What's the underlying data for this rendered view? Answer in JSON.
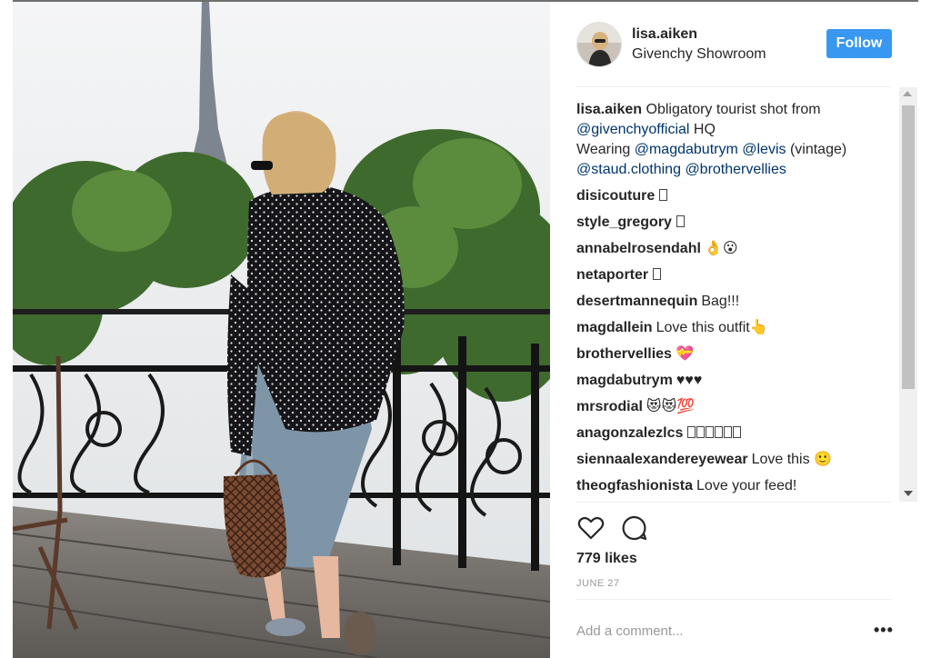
{
  "post": {
    "username": "lisa.aiken",
    "location": "Givenchy Showroom",
    "follow_label": "Follow"
  },
  "caption": {
    "user": "lisa.aiken",
    "lines": [
      [
        {
          "t": "Obligatory tourist shot from",
          "k": "text"
        }
      ],
      [
        {
          "t": "@givenchyofficial",
          "k": "mention"
        },
        {
          "t": " HQ",
          "k": "text"
        }
      ],
      [
        {
          "t": "Wearing ",
          "k": "text"
        },
        {
          "t": "@magdabutrym",
          "k": "mention"
        },
        {
          "t": " ",
          "k": "text"
        },
        {
          "t": "@levis",
          "k": "mention"
        },
        {
          "t": " (vintage)",
          "k": "text"
        }
      ],
      [
        {
          "t": "@staud.clothing",
          "k": "mention"
        },
        {
          "t": " ",
          "k": "text"
        },
        {
          "t": "@brothervellies",
          "k": "mention"
        }
      ]
    ]
  },
  "comments": [
    {
      "user": "disicouture",
      "text": "",
      "boxes": 1
    },
    {
      "user": "style_gregory",
      "text": "",
      "boxes": 1
    },
    {
      "user": "annabelrosendahl",
      "text": "👌😮",
      "boxes": 0
    },
    {
      "user": "netaporter",
      "text": "",
      "boxes": 1
    },
    {
      "user": "desertmannequin",
      "text": "Bag!!!",
      "boxes": 0
    },
    {
      "user": "magdallein",
      "text": "Love this outfit👆",
      "boxes": 0
    },
    {
      "user": "brothervellies",
      "text": "💝",
      "boxes": 0
    },
    {
      "user": "magdabutrym",
      "text": "♥♥♥",
      "boxes": 0
    },
    {
      "user": "mrsrodial",
      "text": "😻😻💯",
      "boxes": 0
    },
    {
      "user": "anagonzalezlcs",
      "text": "",
      "boxes": 6
    },
    {
      "user": "siennaalexandereyewear",
      "text": "Love this 🙂",
      "boxes": 0
    },
    {
      "user": "theogfashionista",
      "text": "Love your feed!",
      "boxes": 0
    }
  ],
  "icons": {
    "like": "heart-icon",
    "comment": "comment-bubble-icon",
    "more": "more-options-icon"
  },
  "likes": "779 likes",
  "date": "JUNE 27",
  "add_comment_placeholder": "Add a comment...",
  "more_label": "•••",
  "colors": {
    "follow_bg": "#3897f0",
    "mention": "#003569",
    "text": "#262626",
    "muted": "#999999"
  }
}
